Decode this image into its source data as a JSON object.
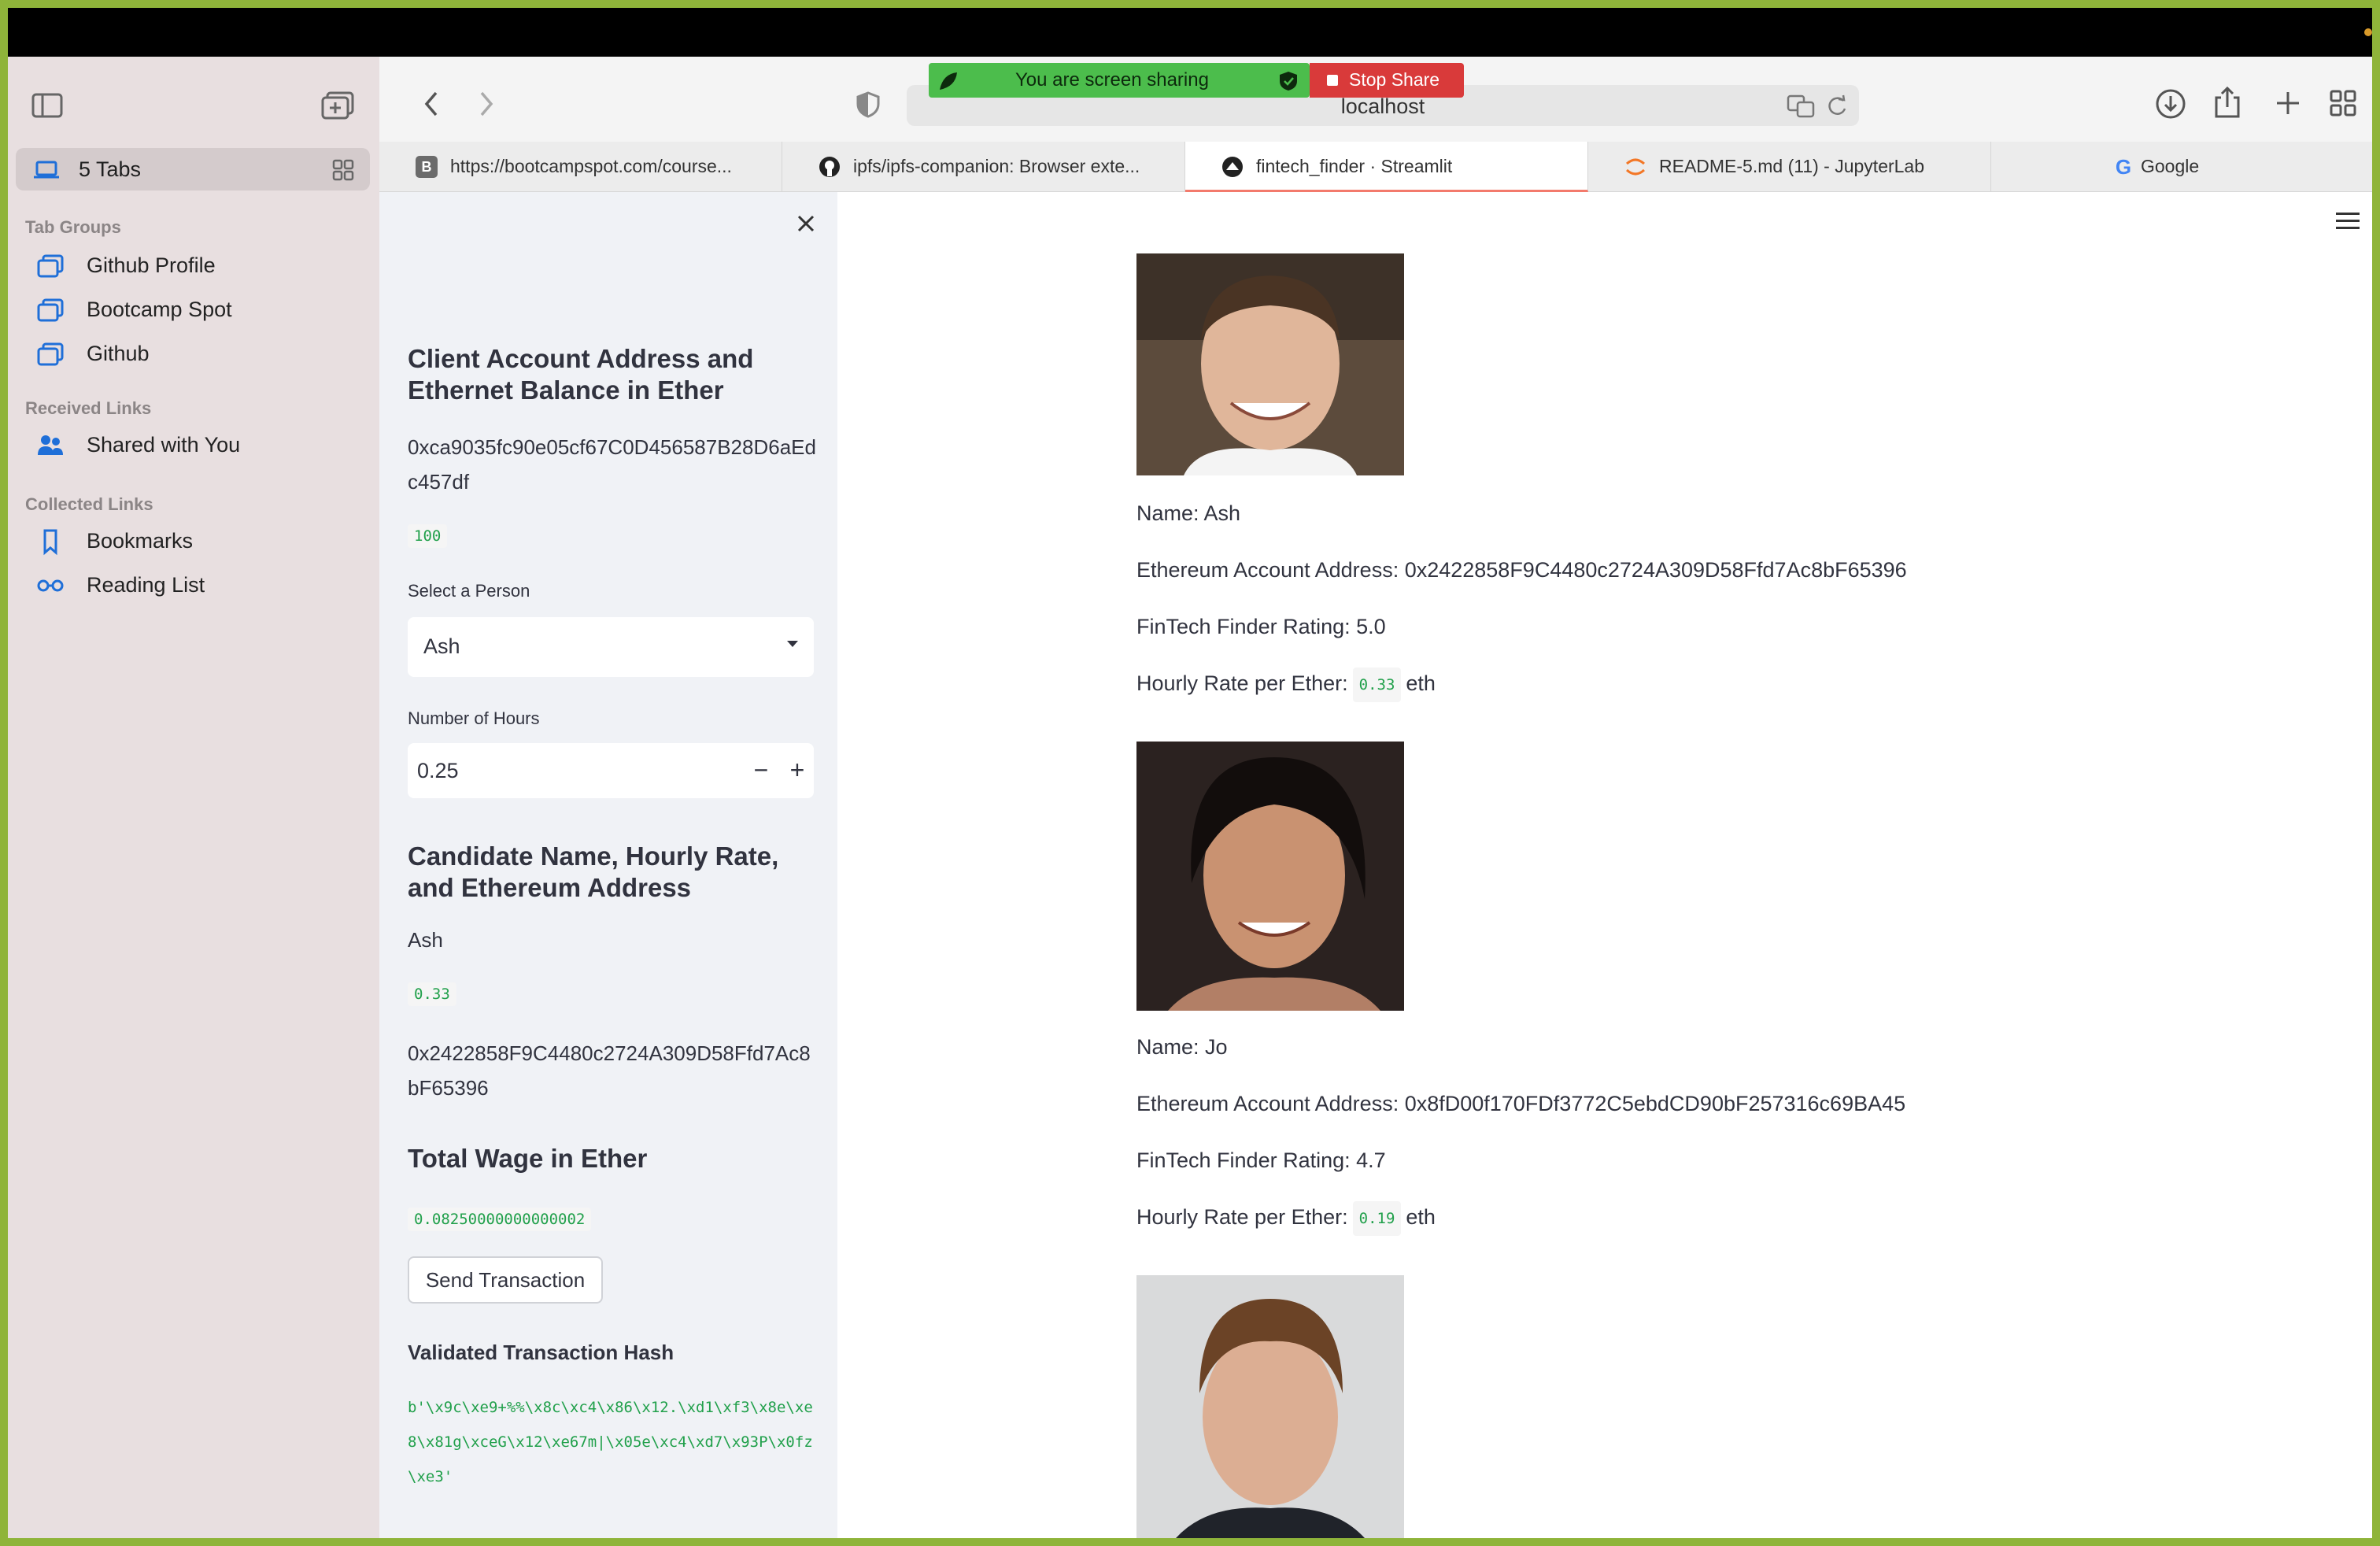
{
  "browser": {
    "url": "localhost",
    "screen_share": {
      "message": "You are screen sharing",
      "stop_label": "Stop Share"
    },
    "tabs": [
      {
        "title": "https://bootcampspot.com/course..."
      },
      {
        "title": "ipfs/ipfs-companion: Browser exte..."
      },
      {
        "title": "fintech_finder · Streamlit"
      },
      {
        "title": "README-5.md (11) - JupyterLab"
      },
      {
        "title": "Google"
      }
    ]
  },
  "sidebar": {
    "tabs_label": "5 Tabs",
    "tab_groups_heading": "Tab Groups",
    "tab_groups": [
      "Github Profile",
      "Bootcamp Spot",
      "Github"
    ],
    "received_heading": "Received Links",
    "received": [
      "Shared with You"
    ],
    "collected_heading": "Collected Links",
    "collected": [
      "Bookmarks",
      "Reading List"
    ]
  },
  "app_sidebar": {
    "client_heading": "Client Account Address and Ethernet Balance in Ether",
    "client_address": "0xca9035fc90e05cf67C0D456587B28D6aEdc457df",
    "client_balance": "100",
    "select_label": "Select a Person",
    "selected_person": "Ash",
    "hours_label": "Number of Hours",
    "hours_value": "0.25",
    "candidate_heading": "Candidate Name, Hourly Rate, and Ethereum Address",
    "candidate_name": "Ash",
    "candidate_rate": "0.33",
    "candidate_address": "0x2422858F9C4480c2724A309D58Ffd7Ac8bF65396",
    "wage_heading": "Total Wage in Ether",
    "wage_value": "0.08250000000000002",
    "send_button": "Send Transaction",
    "hash_heading": "Validated Transaction Hash",
    "hash_value": "b'\\x9c\\xe9+%%\\x8c\\xc4\\x86\\x12.\\xd1\\xf3\\x8e\\xe8\\x81g\\xceG\\x12\\xe67m|\\x05e\\xc4\\xd7\\x93P\\x0fz\\xe3'"
  },
  "candidates": [
    {
      "name_line": "Name: Ash",
      "address_line": "Ethereum Account Address: 0x2422858F9C4480c2724A309D58Ffd7Ac8bF65396",
      "rating_line": "FinTech Finder Rating: 5.0",
      "rate_label": "Hourly Rate per Ether:",
      "rate": "0.33",
      "rate_unit": "eth"
    },
    {
      "name_line": "Name: Jo",
      "address_line": "Ethereum Account Address: 0x8fD00f170FDf3772C5ebdCD90bF257316c69BA45",
      "rating_line": "FinTech Finder Rating: 4.7",
      "rate_label": "Hourly Rate per Ether:",
      "rate": "0.19",
      "rate_unit": "eth"
    }
  ]
}
